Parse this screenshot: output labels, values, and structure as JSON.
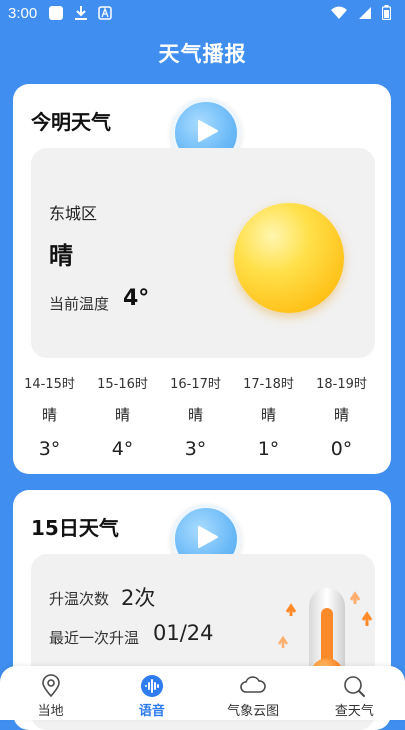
{
  "status_bar": {
    "time": "3:00"
  },
  "app": {
    "title": "天气播报"
  },
  "today_card": {
    "title": "今明天气",
    "district": "东城区",
    "condition": "晴",
    "temp_label": "当前温度",
    "temp_value": "4°",
    "hourly": [
      {
        "time": "14-15时",
        "cond": "晴",
        "temp": "3°"
      },
      {
        "time": "15-16时",
        "cond": "晴",
        "temp": "4°"
      },
      {
        "time": "16-17时",
        "cond": "晴",
        "temp": "3°"
      },
      {
        "time": "17-18时",
        "cond": "晴",
        "temp": "1°"
      },
      {
        "time": "18-19时",
        "cond": "晴",
        "temp": "0°"
      }
    ]
  },
  "day_card": {
    "title": "15日天气",
    "rise_count_label": "升温次数",
    "rise_count_value": "2次",
    "last_rise_label": "最近一次升温",
    "last_rise_value": "01/24"
  },
  "bottom_nav": [
    {
      "label": "当地",
      "icon": "location-pin-icon",
      "active": false
    },
    {
      "label": "语音",
      "icon": "voice-wave-icon",
      "active": true
    },
    {
      "label": "气象云图",
      "icon": "cloud-icon",
      "active": false
    },
    {
      "label": "查天气",
      "icon": "search-icon",
      "active": false
    }
  ],
  "colors": {
    "background": "#3f8ef0",
    "accent": "#2e7cf0",
    "panel": "#f1f1f1"
  }
}
